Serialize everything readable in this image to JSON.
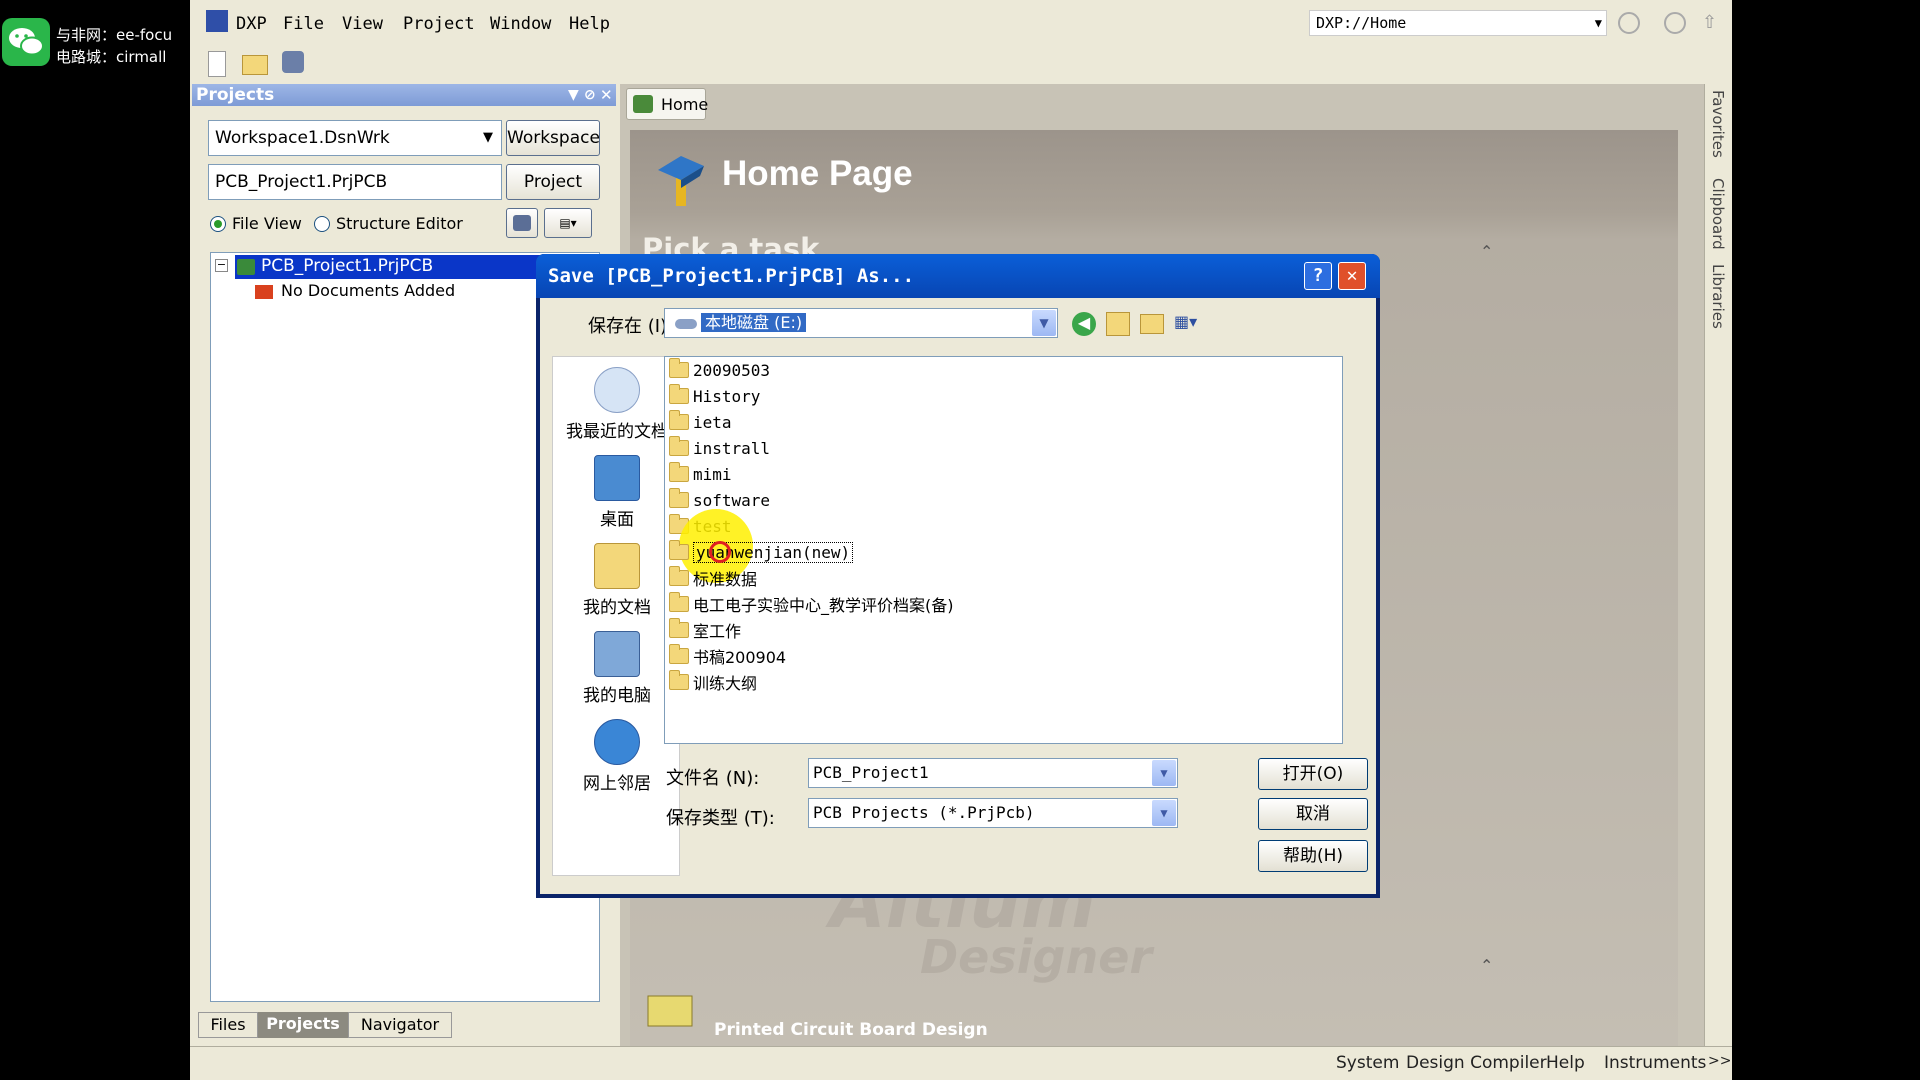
{
  "watermark": {
    "line1": "与非网：ee-focu",
    "line2": "电路城：cirmall"
  },
  "menu": [
    "DXP",
    "File",
    "View",
    "Project",
    "Window",
    "Help"
  ],
  "address": "DXP://Home",
  "projects_panel": {
    "title": "Projects",
    "workspace": "Workspace1.DsnWrk",
    "workspace_btn": "Workspace",
    "project": "PCB_Project1.PrjPCB",
    "project_btn": "Project",
    "radio_file": "File View",
    "radio_struct": "Structure Editor",
    "tree_root": "PCB_Project1.PrjPCB",
    "tree_child": "No Documents Added",
    "tabs": [
      "Files",
      "Projects",
      "Navigator"
    ]
  },
  "home": {
    "tab": "Home",
    "title": "Home Page",
    "pick": "Pick a task",
    "footer_task": "Printed Circuit Board Design",
    "logo": "Altium",
    "logo2": "Designer"
  },
  "side_tabs": [
    "Favorites",
    "Clipboard",
    "Libraries"
  ],
  "status": [
    "System",
    "Design Compiler",
    "Help",
    "Instruments",
    ">>"
  ],
  "dialog": {
    "title": "Save [PCB_Project1.PrjPCB] As...",
    "save_in_label": "保存在 (I):",
    "save_in_value": "本地磁盘 (E:)",
    "places": [
      "我最近的文档",
      "桌面",
      "我的文档",
      "我的电脑",
      "网上邻居"
    ],
    "folders": [
      "20090503",
      "History",
      "ieta",
      "instrall",
      "mimi",
      "software",
      "test",
      "yuanwenjian(new)",
      "标准数据",
      "电工电子实验中心_教学评价档案(备)",
      "室工作",
      "书稿200904",
      "训练大纲"
    ],
    "filename_label": "文件名 (N):",
    "filename_value": "PCB_Project1",
    "filetype_label": "保存类型 (T):",
    "filetype_value": "PCB Projects (*.PrjPcb)",
    "btn_open": "打开(O)",
    "btn_cancel": "取消",
    "btn_help": "帮助(H)"
  }
}
